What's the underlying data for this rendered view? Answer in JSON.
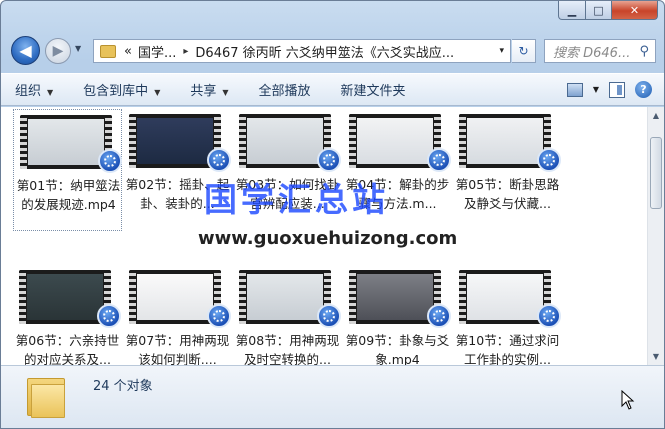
{
  "window": {
    "min_label": "▁",
    "max_label": "□",
    "close_label": "✕"
  },
  "nav": {
    "back_icon": "◀",
    "forward_icon": "▶"
  },
  "address": {
    "prefix": "«",
    "crumbs": [
      "国学...",
      "D6467 徐丙昕 六爻纳甲筮法《六爻实战应..."
    ],
    "separator": "▸",
    "dropdown": "▾"
  },
  "refresh_icon": "↻",
  "search": {
    "placeholder": "搜索 D646...",
    "icon": "⚲"
  },
  "toolbar": {
    "organize": "组织",
    "include_library": "包含到库中",
    "share": "共享",
    "play_all": "全部播放",
    "new_folder": "新建文件夹",
    "arrow": "▼"
  },
  "files": [
    {
      "label": "第01节：纳甲筮法的发展规迹.mp4",
      "selected": true
    },
    {
      "label": "第02节：摇卦、起卦、装卦的..."
    },
    {
      "label": "第03节：如何找卦宫辨配应装..."
    },
    {
      "label": "第04节：解卦的步骤与方法.m..."
    },
    {
      "label": "第05节：断卦思路及静爻与伏藏..."
    },
    {
      "label": "第06节：六亲持世的对应关系及..."
    },
    {
      "label": "第07节：用神两现该如何判断...."
    },
    {
      "label": "第08节：用神两现及时空转换的..."
    },
    {
      "label": "第09节：卦象与爻象.mp4"
    },
    {
      "label": "第10节：通过求问工作卦的实例..."
    }
  ],
  "watermark": {
    "cn": "国学汇总站",
    "url": "www.guoxuehuizong.com"
  },
  "status": {
    "count": "24 个对象"
  },
  "colors": {
    "accent": "#1a47ff",
    "toolbar_text": "#1e395b"
  }
}
